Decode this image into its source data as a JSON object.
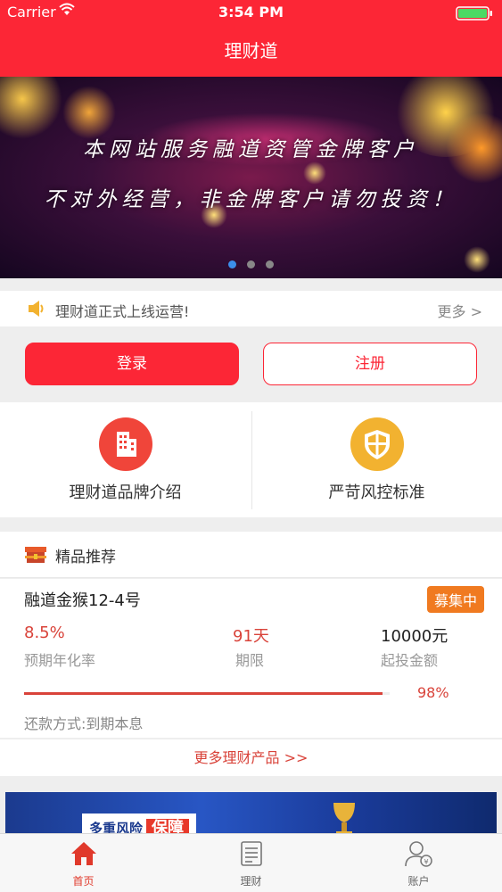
{
  "status_bar": {
    "carrier": "Carrier",
    "time": "3:54 PM"
  },
  "nav": {
    "title": "理财道"
  },
  "banner": {
    "line1": "本网站服务融道资管金牌客户",
    "line2": "不对外经营，非金牌客户请勿投资！",
    "page_count": 3,
    "active_page": 1
  },
  "notice": {
    "text": "理财道正式上线运营!",
    "more": "更多 >"
  },
  "auth": {
    "login": "登录",
    "register": "注册"
  },
  "features": [
    {
      "label": "理财道品牌介绍",
      "icon": "building-icon",
      "color": "#f0453a"
    },
    {
      "label": "严苛风控标准",
      "icon": "shield-icon",
      "color": "#f2b230"
    }
  ],
  "recommend": {
    "title": "精品推荐"
  },
  "product": {
    "name": "融道金猴12-4号",
    "status": "募集中",
    "rate_value": "8.5%",
    "rate_label": "预期年化率",
    "term_value": "91天",
    "term_label": "期限",
    "min_value": "10000元",
    "min_label": "起投金额",
    "progress_text": "98%",
    "progress_fraction": 0.98,
    "repay": "还款方式:到期本息"
  },
  "more_products": "更多理财产品 >>",
  "ad": {
    "text1": "多重风险",
    "text2": "保障"
  },
  "tabs": [
    {
      "label": "首页",
      "icon": "home-icon",
      "active": true
    },
    {
      "label": "理财",
      "icon": "list-icon",
      "active": false
    },
    {
      "label": "账户",
      "icon": "account-icon",
      "active": false
    }
  ],
  "colors": {
    "brand": "#fc2636",
    "accent_orange": "#f07a20",
    "progress": "#d9433a"
  }
}
